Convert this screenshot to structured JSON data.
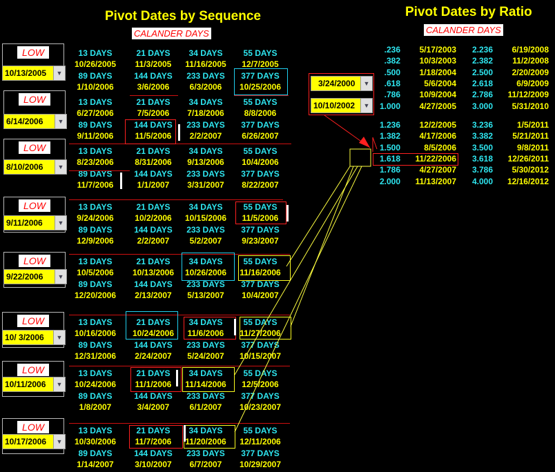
{
  "left": {
    "title": "Pivot Dates by Sequence",
    "subtitle": "CALANDER DAYS",
    "low_label": "LOW",
    "blocks": [
      {
        "date": "10/13/2005",
        "row1_labels": [
          "13 DAYS",
          "21 DAYS",
          "34 DAYS",
          "55 DAYS"
        ],
        "row1_dates": [
          "10/26/2005",
          "11/3/2005",
          "11/16/2005",
          "12/7/2005"
        ],
        "row2_labels": [
          "89 DAYS",
          "144 DAYS",
          "233 DAYS",
          "377 DAYS"
        ],
        "row2_dates": [
          "1/10/2006",
          "3/6/2006",
          "6/3/2006",
          "10/25/2006"
        ]
      },
      {
        "date": "6/14/2006",
        "row1_labels": [
          "13 DAYS",
          "21 DAYS",
          "34 DAYS",
          "55 DAYS"
        ],
        "row1_dates": [
          "6/27/2006",
          "7/5/2006",
          "7/18/2006",
          "8/8/2006"
        ],
        "row2_labels": [
          "89 DAYS",
          "144 DAYS",
          "233 DAYS",
          "377 DAYS"
        ],
        "row2_dates": [
          "9/11/2006",
          "11/5/2006",
          "2/2/2007",
          "6/26/2007"
        ]
      },
      {
        "date": "8/10/2006",
        "row1_labels": [
          "13 DAYS",
          "21 DAYS",
          "34 DAYS",
          "55 DAYS"
        ],
        "row1_dates": [
          "8/23/2006",
          "8/31/2006",
          "9/13/2006",
          "10/4/2006"
        ],
        "row2_labels": [
          "89 DAYS",
          "144 DAYS",
          "233 DAYS",
          "377 DAYS"
        ],
        "row2_dates": [
          "11/7/2006",
          "1/1/2007",
          "3/31/2007",
          "8/22/2007"
        ]
      },
      {
        "date": "9/11/2006",
        "row1_labels": [
          "13 DAYS",
          "21 DAYS",
          "34 DAYS",
          "55 DAYS"
        ],
        "row1_dates": [
          "9/24/2006",
          "10/2/2006",
          "10/15/2006",
          "11/5/2006"
        ],
        "row2_labels": [
          "89 DAYS",
          "144 DAYS",
          "233 DAYS",
          "377 DAYS"
        ],
        "row2_dates": [
          "12/9/2006",
          "2/2/2007",
          "5/2/2007",
          "9/23/2007"
        ]
      },
      {
        "date": "9/22/2006",
        "row1_labels": [
          "13 DAYS",
          "21 DAYS",
          "34 DAYS",
          "55 DAYS"
        ],
        "row1_dates": [
          "10/5/2006",
          "10/13/2006",
          "10/26/2006",
          "11/16/2006"
        ],
        "row2_labels": [
          "89 DAYS",
          "144 DAYS",
          "233 DAYS",
          "377 DAYS"
        ],
        "row2_dates": [
          "12/20/2006",
          "2/13/2007",
          "5/13/2007",
          "10/4/2007"
        ]
      },
      {
        "date": "10/  3/2006",
        "row1_labels": [
          "13 DAYS",
          "21 DAYS",
          "34 DAYS",
          "55 DAYS"
        ],
        "row1_dates": [
          "10/16/2006",
          "10/24/2006",
          "11/6/2006",
          "11/27/2006"
        ],
        "row2_labels": [
          "89 DAYS",
          "144 DAYS",
          "233 DAYS",
          "377 DAYS"
        ],
        "row2_dates": [
          "12/31/2006",
          "2/24/2007",
          "5/24/2007",
          "10/15/2007"
        ]
      },
      {
        "date": "10/11/2006",
        "row1_labels": [
          "13 DAYS",
          "21 DAYS",
          "34 DAYS",
          "55 DAYS"
        ],
        "row1_dates": [
          "10/24/2006",
          "11/1/2006",
          "11/14/2006",
          "12/5/2006"
        ],
        "row2_labels": [
          "89 DAYS",
          "144 DAYS",
          "233 DAYS",
          "377 DAYS"
        ],
        "row2_dates": [
          "1/8/2007",
          "3/4/2007",
          "6/1/2007",
          "10/23/2007"
        ]
      },
      {
        "date": "10/17/2006",
        "row1_labels": [
          "13 DAYS",
          "21 DAYS",
          "34 DAYS",
          "55 DAYS"
        ],
        "row1_dates": [
          "10/30/2006",
          "11/7/2006",
          "11/20/2006",
          "12/11/2006"
        ],
        "row2_labels": [
          "89 DAYS",
          "144 DAYS",
          "233 DAYS",
          "377 DAYS"
        ],
        "row2_dates": [
          "1/14/2007",
          "3/10/2007",
          "6/7/2007",
          "10/29/2007"
        ]
      }
    ]
  },
  "right": {
    "title": "Pivot Dates by Ratio",
    "subtitle": "CALANDER DAYS",
    "date_a": "3/24/2000",
    "date_b": "10/10/2002",
    "group1": [
      [
        ".236",
        "5/17/2003",
        "2.236",
        "6/19/2008"
      ],
      [
        ".382",
        "10/3/2003",
        "2.382",
        "11/2/2008"
      ],
      [
        ".500",
        "1/18/2004",
        "2.500",
        "2/20/2009"
      ],
      [
        ".618",
        "5/6/2004",
        "2.618",
        "6/9/2009"
      ],
      [
        ".786",
        "10/9/2004",
        "2.786",
        "11/12/2009"
      ],
      [
        "1.000",
        "4/27/2005",
        "3.000",
        "5/31/2010"
      ]
    ],
    "group2": [
      [
        "1.236",
        "12/2/2005",
        "3.236",
        "1/5/2011"
      ],
      [
        "1.382",
        "4/17/2006",
        "3.382",
        "5/21/2011"
      ],
      [
        "1.500",
        "8/5/2006",
        "3.500",
        "9/8/2011"
      ],
      [
        "1.618",
        "11/22/2006",
        "3.618",
        "12/26/2011"
      ],
      [
        "1.786",
        "4/27/2007",
        "3.786",
        "5/30/2012"
      ],
      [
        "2.000",
        "11/13/2007",
        "4.000",
        "12/16/2012"
      ]
    ]
  },
  "colors": {
    "background": "#000000",
    "ratio": "#2ee6f0",
    "date": "#ffff00",
    "highlight": "#ff0000"
  },
  "icons": {
    "dropdown": "chevron-down-icon"
  }
}
